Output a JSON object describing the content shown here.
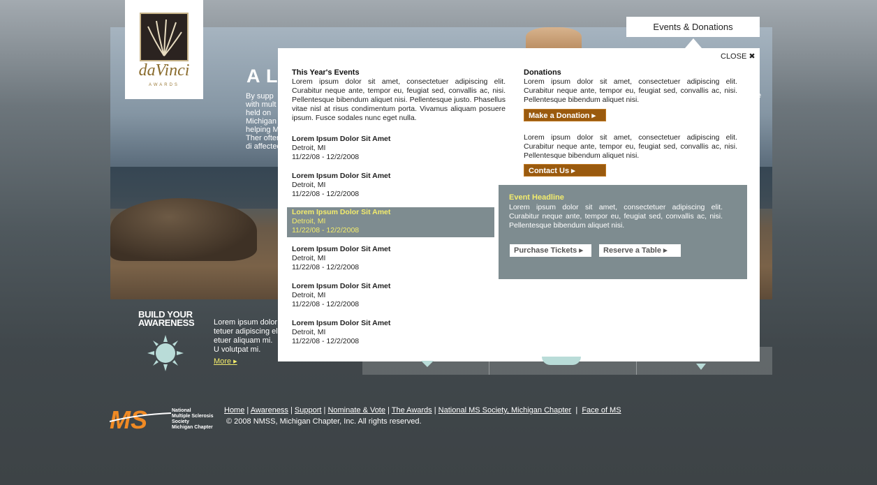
{
  "hero": {
    "title": "A LI",
    "body": "By supp with mult held on Michigan helping MS. Ther often di affected",
    "right_fragment": "e"
  },
  "logo": {
    "wordmark": "daVinci",
    "sub": "AWARDS"
  },
  "tab": {
    "label": "Events & Donations"
  },
  "panel": {
    "close_label": "CLOSE ✖",
    "events": {
      "heading": "This Year's Events",
      "intro": "Lorem ipsum dolor sit amet, consectetuer adipiscing elit. Curabitur neque ante, tempor eu, feugiat sed, convallis ac, nisi. Pellentesque bibendum aliquet nisi. Pellentesque justo. Phasellus vitae nisl at risus condimentum porta. Vivamus aliquam posuere ipsum. Fusce sodales nunc eget nulla.",
      "items": [
        {
          "title": "Lorem Ipsum Dolor Sit Amet",
          "location": "Detroit, MI",
          "dates": "11/22/08 - 12/2/2008"
        },
        {
          "title": "Lorem Ipsum Dolor Sit Amet",
          "location": "Detroit, MI",
          "dates": "11/22/08 - 12/2/2008"
        },
        {
          "title": "Lorem Ipsum Dolor Sit Amet",
          "location": "Detroit, MI",
          "dates": "11/22/08 - 12/2/2008"
        },
        {
          "title": "Lorem Ipsum Dolor Sit Amet",
          "location": "Detroit, MI",
          "dates": "11/22/08 - 12/2/2008"
        },
        {
          "title": "Lorem Ipsum Dolor Sit Amet",
          "location": "Detroit, MI",
          "dates": "11/22/08 - 12/2/2008"
        },
        {
          "title": "Lorem Ipsum Dolor Sit Amet",
          "location": "Detroit, MI",
          "dates": "11/22/08 - 12/2/2008"
        }
      ]
    },
    "donations": {
      "heading": "Donations",
      "body1": "Lorem ipsum dolor sit amet, consectetuer adipiscing elit. Curabitur neque ante, tempor eu, feugiat sed, convallis ac, nisi. Pellentesque bibendum aliquet nisi.",
      "donate_button": "Make a Donation",
      "body2": "Lorem ipsum dolor sit amet, consectetuer adipiscing elit. Curabitur neque ante, tempor eu, feugiat sed, convallis ac, nisi. Pellentesque bibendum aliquet nisi.",
      "contact_button": "Contact Us"
    },
    "feature": {
      "headline": "Event Headline",
      "body": "Lorem ipsum dolor sit amet, consectetuer adipiscing elit. Curabitur neque ante, tempor eu, feugiat sed, convallis ac, nisi. Pellentesque bibendum aliquet nisi.",
      "tickets_button": "Purchase Tickets",
      "table_button": "Reserve a Table"
    }
  },
  "awareness": {
    "title_line1": "BUILD YOUR",
    "title_line2": "AWARENESS",
    "text": "Lorem ipsum dolor tetuer adipiscing el etuer aliquam mi. U volutpat mi.",
    "more_label": "More"
  },
  "footer": {
    "ms_mark": "MS",
    "ms_org": [
      "National",
      "Multiple Sclerosis",
      "Society",
      "Michigan Chapter"
    ],
    "nav": [
      "Home",
      "Awareness",
      "Support",
      "Nominate & Vote",
      "The Awards",
      "National MS Society, Michigan Chapter",
      "Face of MS"
    ],
    "copyright": "© 2008 NMSS, Michigan Chapter, Inc. All rights reserved."
  },
  "colors": {
    "accent_orange": "#9a5a0e",
    "highlight_yellow": "#f3ec6c",
    "panel_gray": "#7e8c90",
    "ms_orange": "#f08a24"
  }
}
